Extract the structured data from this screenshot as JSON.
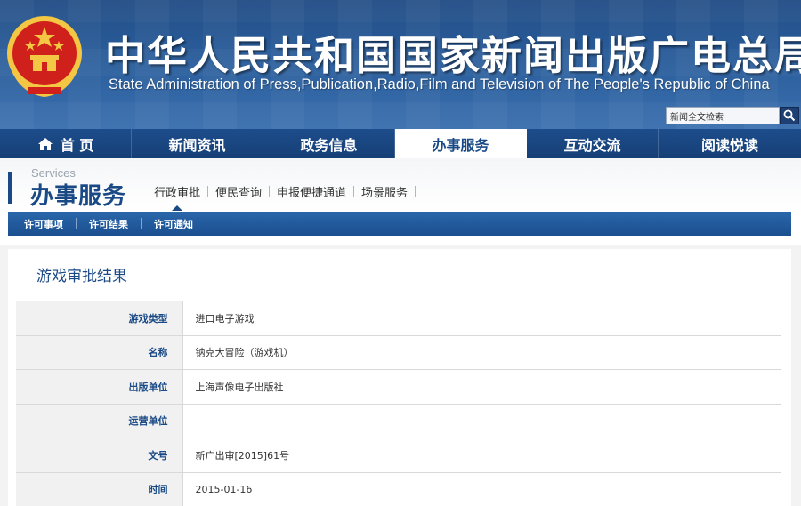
{
  "header": {
    "title_cn": "中华人民共和国国家新闻出版广电总局",
    "title_en": "State Administration of Press,Publication,Radio,Film and Television of The People's Republic of China",
    "search_placeholder": "新闻全文检索",
    "emblem_icon": "national-emblem-icon",
    "search_icon": "search-icon"
  },
  "nav": {
    "items": [
      {
        "label": "首 页",
        "icon": "home-icon"
      },
      {
        "label": "新闻资讯"
      },
      {
        "label": "政务信息"
      },
      {
        "label": "办事服务",
        "active": true
      },
      {
        "label": "互动交流"
      },
      {
        "label": "阅读悦读"
      }
    ]
  },
  "section": {
    "en": "Services",
    "cn": "办事服务",
    "subnav": [
      "行政审批",
      "便民查询",
      "申报便捷通道",
      "场景服务"
    ]
  },
  "tabs": [
    "许可事项",
    "许可结果",
    "许可通知"
  ],
  "content": {
    "title": "游戏审批结果",
    "rows": [
      {
        "label": "游戏类型",
        "value": "进口电子游戏"
      },
      {
        "label": "名称",
        "value": "钠克大冒险（游戏机）"
      },
      {
        "label": "出版单位",
        "value": "上海声像电子出版社"
      },
      {
        "label": "运营单位",
        "value": ""
      },
      {
        "label": "文号",
        "value": "新广出审[2015]61号"
      },
      {
        "label": "时间",
        "value": "2015-01-16"
      }
    ]
  },
  "colors": {
    "brand_blue": "#1a4a86",
    "banner_blue": "#2a5d9b",
    "emblem_red": "#d0201c",
    "emblem_gold": "#f3c744"
  }
}
